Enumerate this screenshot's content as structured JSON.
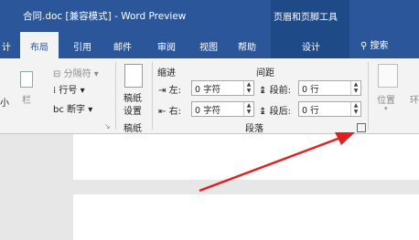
{
  "window": {
    "title": "合同.doc [兼容模式] - Word Preview",
    "context_tab_group": "页眉和页脚工具"
  },
  "tabs": {
    "items": [
      "计",
      "布局",
      "引用",
      "邮件",
      "审阅",
      "视图",
      "帮助"
    ],
    "context_tab": "设计",
    "search_label": "搜索",
    "active": "布局"
  },
  "ribbon": {
    "left_partial": [
      "小",
      "栏"
    ],
    "breaks": "分隔符",
    "line_numbers": "行号",
    "hyphenation": "断字",
    "manuscript": {
      "line1": "稿纸",
      "line2": "设置",
      "group": "稿纸"
    },
    "indent": {
      "title": "缩进",
      "left_label": "左:",
      "left_value": "0 字符",
      "right_label": "右:",
      "right_value": "0 字符"
    },
    "spacing": {
      "title": "间距",
      "before_label": "段前:",
      "before_value": "0 行",
      "after_label": "段后:",
      "after_value": "0 行"
    },
    "paragraph_group": "段落",
    "position": "位置",
    "right_partial": "环"
  },
  "colors": {
    "accent": "#2b579a",
    "context": "#1e4a88",
    "arrow": "#e02020"
  }
}
